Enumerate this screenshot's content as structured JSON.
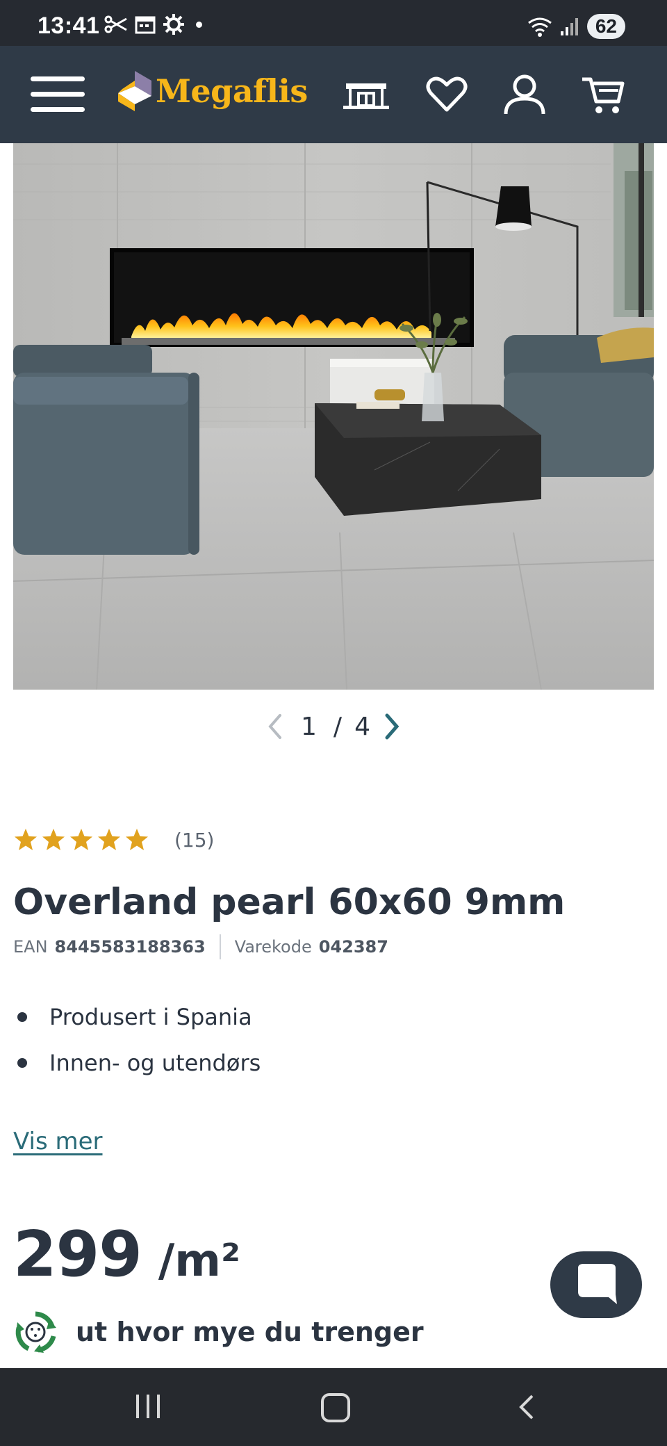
{
  "status_bar": {
    "time": "13:41",
    "battery": "62",
    "icons": [
      "scissors-icon",
      "calendar-icon",
      "gear-icon",
      "wifi-icon",
      "signal-icon"
    ]
  },
  "header": {
    "logo_text": "Megaflis",
    "icons": [
      "menu-icon",
      "store-icon",
      "heart-icon",
      "account-icon",
      "cart-icon"
    ],
    "brand_color": "#f7b61a",
    "background_color": "#2f3a47"
  },
  "gallery": {
    "current": "1",
    "separator": "/",
    "total": "4"
  },
  "product": {
    "rating": 5,
    "review_count": "(15)",
    "title": "Overland pearl 60x60 9mm",
    "ean_label": "EAN",
    "ean_value": "8445583188363",
    "sku_label": "Varekode",
    "sku_value": "042387",
    "bullets": [
      "Produsert i Spania",
      "Innen- og utendørs"
    ],
    "more_link": "Vis mer",
    "price": "299",
    "price_unit": "/m²",
    "calculator_text": "ut hvor mye du trenger"
  },
  "colors": {
    "star": "#e1a21e",
    "link": "#2a6b78",
    "text": "#2b3441"
  }
}
